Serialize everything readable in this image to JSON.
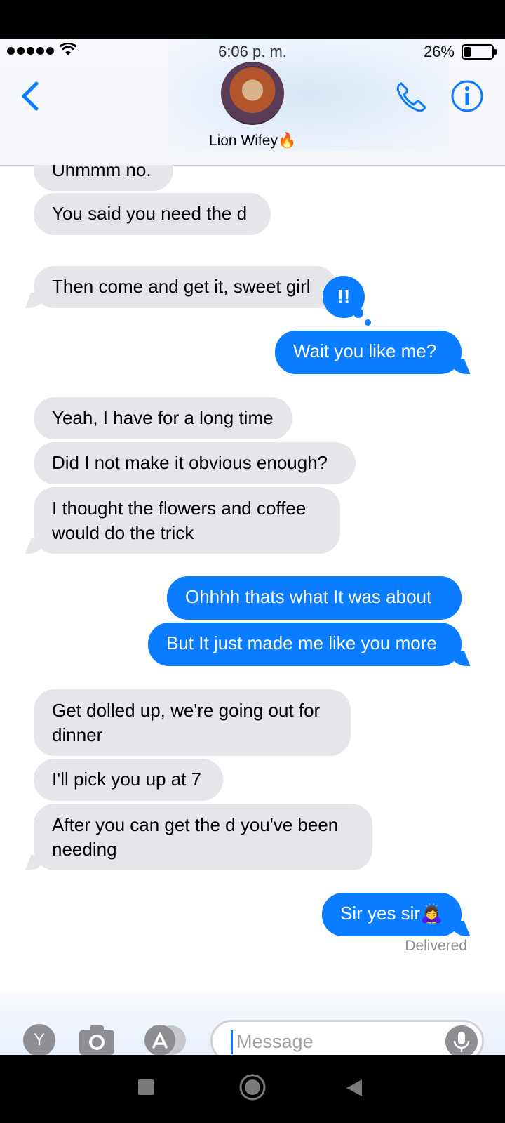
{
  "status_bar": {
    "time": "6:06 p. m.",
    "battery": "26%"
  },
  "header": {
    "contact_name": "Lion Wifey🔥"
  },
  "messages": [
    {
      "text": "Uhmmm no."
    },
    {
      "text": "You said you need the d"
    },
    {
      "text": "Then come and get it, sweet girl",
      "reaction": "!!"
    },
    {
      "text": "Wait you like me?"
    },
    {
      "text": "Yeah, I have for a long time"
    },
    {
      "text": "Did I not make it obvious enough?"
    },
    {
      "line1": "I thought the flowers and coffee",
      "line2": "would do the trick"
    },
    {
      "text": "Ohhhh thats what It was about"
    },
    {
      "text": "But It just made me like you more"
    },
    {
      "line1": "Get dolled up, we're going out for",
      "line2": "dinner"
    },
    {
      "text": "I'll pick you up at 7"
    },
    {
      "line1": "After you can get the d you've been",
      "line2": "needing"
    },
    {
      "text": "Sir yes sir🙇‍♀️"
    }
  ],
  "delivered_label": "Delivered",
  "input": {
    "placeholder": "Message",
    "app_letter": "Y"
  },
  "colors": {
    "outgoing": "#0a7cff",
    "incoming": "#e5e5ea",
    "accent": "#0a7cff"
  }
}
